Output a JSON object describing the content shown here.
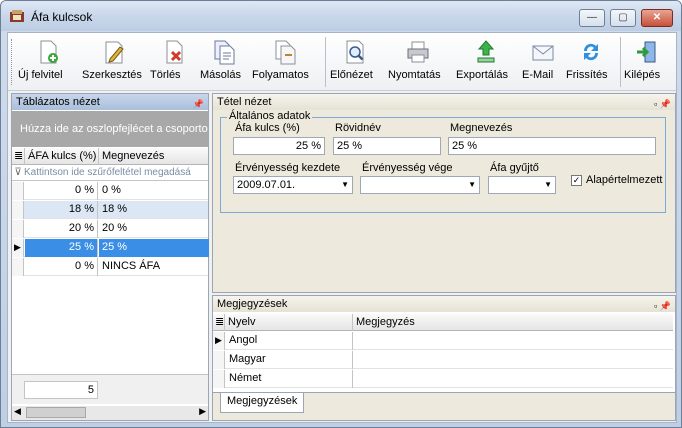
{
  "window": {
    "title": "Áfa kulcsok",
    "min_label": "—",
    "max_label": "▢",
    "close_label": "✕"
  },
  "toolbar": {
    "items": [
      {
        "label": "Új felvitel",
        "icon": "new-doc-icon"
      },
      {
        "label": "Szerkesztés",
        "icon": "edit-icon"
      },
      {
        "label": "Törlés",
        "icon": "delete-icon"
      },
      {
        "label": "Másolás",
        "icon": "copy-icon"
      },
      {
        "label": "Folyamatos",
        "icon": "continuous-icon"
      },
      {
        "label": "Előnézet",
        "icon": "preview-icon"
      },
      {
        "label": "Nyomtatás",
        "icon": "print-icon"
      },
      {
        "label": "Exportálás",
        "icon": "export-icon"
      },
      {
        "label": "E-Mail",
        "icon": "email-icon"
      },
      {
        "label": "Frissítés",
        "icon": "refresh-icon"
      },
      {
        "label": "Kilépés",
        "icon": "exit-icon"
      }
    ]
  },
  "left_panel": {
    "title": "Táblázatos nézet",
    "group_hint": "Húzza ide az oszlopfejlécet a csoportos",
    "columns": [
      "ÁFA kulcs (%)",
      "Megnevezés"
    ],
    "filter_hint": "Kattintson ide szűrőfeltétel megadásá",
    "rows": [
      {
        "rate": "0 %",
        "name": "0 %"
      },
      {
        "rate": "18 %",
        "name": "18 %"
      },
      {
        "rate": "20 %",
        "name": "20 %"
      },
      {
        "rate": "25 %",
        "name": "25 %"
      },
      {
        "rate": "0 %",
        "name": "NINCS ÁFA"
      }
    ],
    "count": "5"
  },
  "detail": {
    "title": "Tétel nézet",
    "group_title": "Általános adatok",
    "afa_label": "Áfa kulcs (%)",
    "afa_value": "25 %",
    "short_label": "Rövidnév",
    "short_value": "25 %",
    "name_label": "Megnevezés",
    "name_value": "25 %",
    "valid_from_label": "Érvényesség kezdete",
    "valid_from_value": "2009.07.01.",
    "valid_to_label": "Érvényesség vége",
    "valid_to_value": "",
    "collector_label": "Áfa gyűjtő",
    "collector_value": "",
    "default_label": "Alapértelmezett",
    "default_checked": true
  },
  "notes": {
    "title": "Megjegyzések",
    "columns": [
      "Nyelv",
      "Megjegyzés"
    ],
    "rows": [
      {
        "lang": "Angol",
        "note": ""
      },
      {
        "lang": "Magyar",
        "note": ""
      },
      {
        "lang": "Német",
        "note": ""
      }
    ],
    "tab_label": "Megjegyzések"
  }
}
